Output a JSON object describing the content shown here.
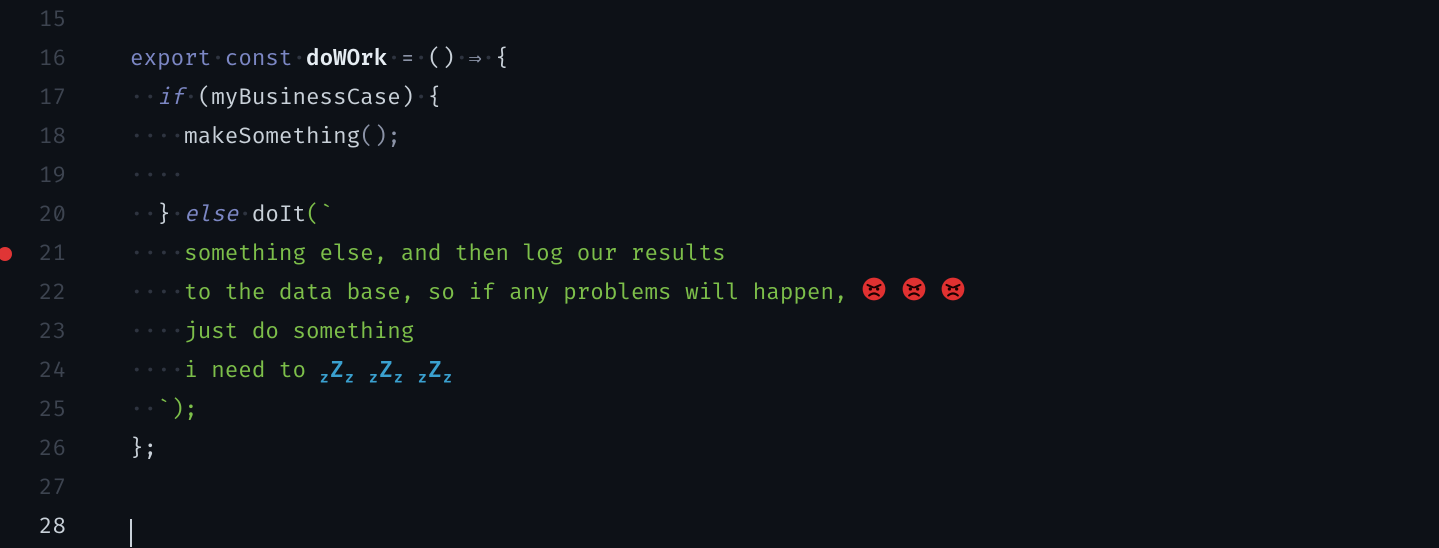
{
  "line_numbers": [
    "15",
    "16",
    "17",
    "18",
    "19",
    "20",
    "21",
    "22",
    "23",
    "24",
    "25",
    "26",
    "27",
    "28"
  ],
  "breakpoint_line": "21",
  "current_line": "28",
  "tokens": {
    "kw_export": "export",
    "kw_const": "const",
    "fn_doWork": "doWOrk",
    "eq": "=",
    "empty_parens": "()",
    "arrow": "⇒",
    "open_brace": "{",
    "kw_if": "if",
    "open_paren": "(",
    "var_myBusinessCase": "myBusinessCase",
    "close_paren": ")",
    "fn_makeSomething": "makeSomething",
    "call_parens_semicolon": "();",
    "close_brace": "}",
    "kw_else": "else",
    "fn_doIt": "doIt",
    "backtick_open": "(`",
    "str_line1": "something else, and then log our results",
    "str_line2": "to the data base, so if any problems will happen, ",
    "str_line3": "just do something",
    "str_line4_prefix": "i need to ",
    "zzz1": "zZz",
    "zzz2": "zZz",
    "zzz3": "zZz",
    "backtick_close": "`);",
    "end_brace_semi": "};"
  },
  "emoji": {
    "angry_count": 3,
    "sleep_count": 3
  },
  "whitespace_dot": "·"
}
